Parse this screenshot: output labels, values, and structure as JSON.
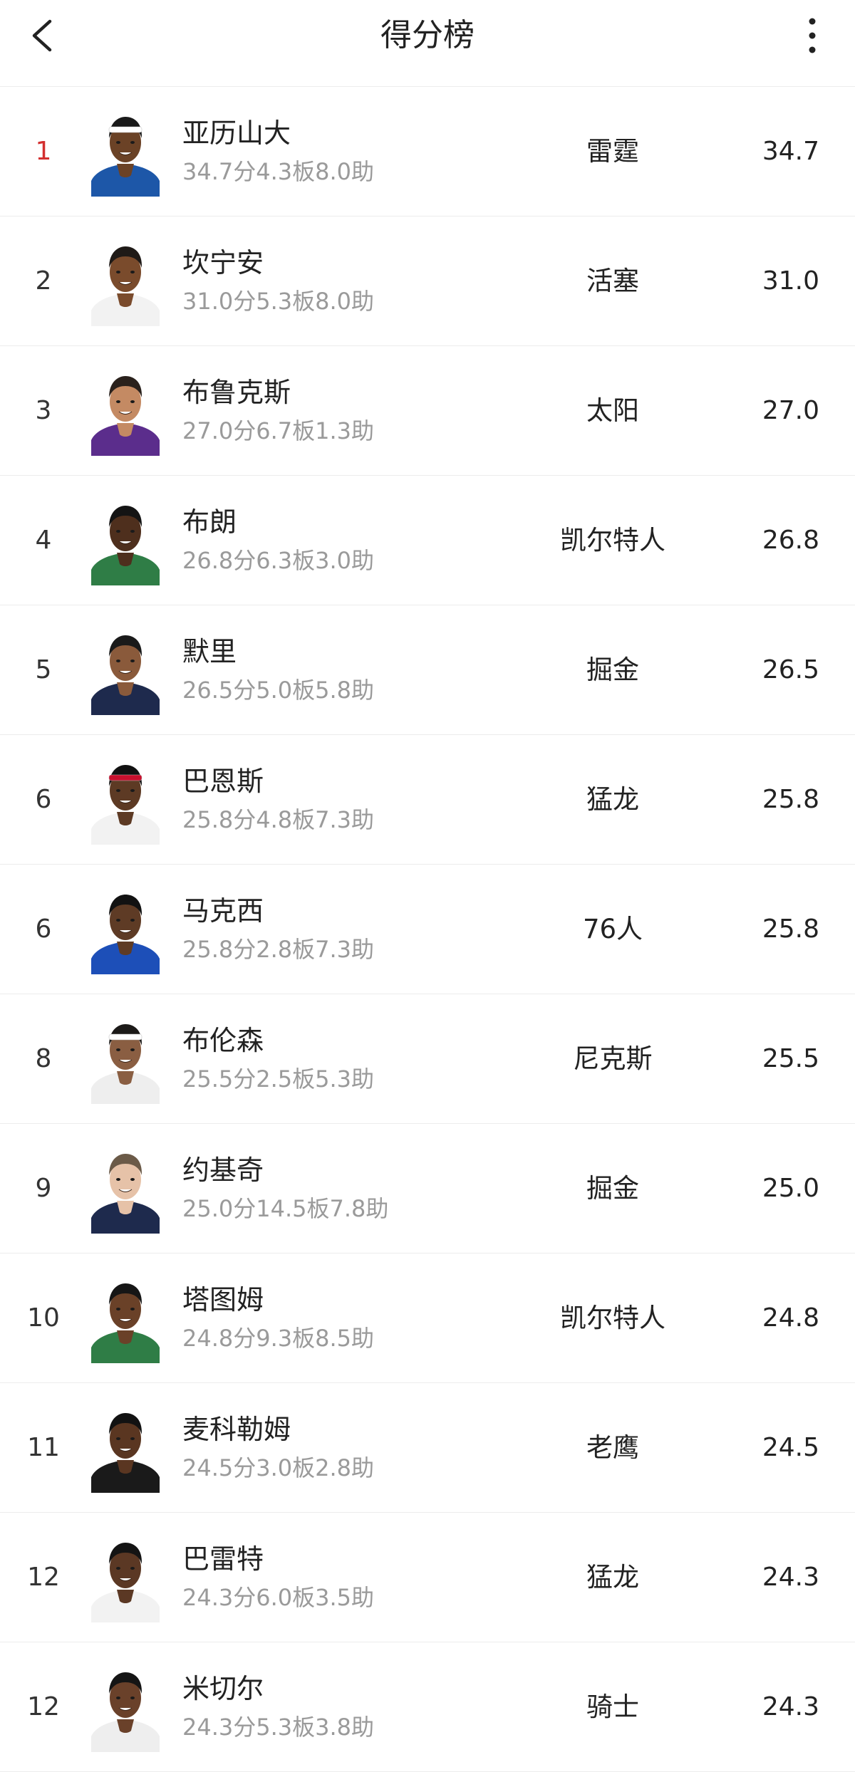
{
  "header": {
    "title": "得分榜",
    "back_icon": "chevron-left-icon",
    "more_icon": "more-vertical-icon"
  },
  "colors": {
    "rank_highlight": "#d32f2f",
    "stats_text": "#9a9a9a",
    "divider": "#ececec"
  },
  "players": [
    {
      "rank": "1",
      "name": "亚历山大",
      "stats": "34.7分4.3板8.0助",
      "team": "雷霆",
      "points": "34.7",
      "jersey": "#1d57a8",
      "skin": "#6b4226",
      "hair": "#1a1a1a",
      "band": "#ffffff"
    },
    {
      "rank": "2",
      "name": "坎宁安",
      "stats": "31.0分5.3板8.0助",
      "team": "活塞",
      "points": "31.0",
      "jersey": "#f2f2f2",
      "skin": "#7a4b2c",
      "hair": "#1f1a17",
      "band": ""
    },
    {
      "rank": "3",
      "name": "布鲁克斯",
      "stats": "27.0分6.7板1.3助",
      "team": "太阳",
      "points": "27.0",
      "jersey": "#5b2d8c",
      "skin": "#c48a63",
      "hair": "#2a211c",
      "band": ""
    },
    {
      "rank": "4",
      "name": "布朗",
      "stats": "26.8分6.3板3.0助",
      "team": "凯尔特人",
      "points": "26.8",
      "jersey": "#2f7d46",
      "skin": "#4e2f1d",
      "hair": "#141414",
      "band": ""
    },
    {
      "rank": "5",
      "name": "默里",
      "stats": "26.5分5.0板5.8助",
      "team": "掘金",
      "points": "26.5",
      "jersey": "#1e2a4d",
      "skin": "#8a5a3b",
      "hair": "#1a1a1a",
      "band": ""
    },
    {
      "rank": "6",
      "name": "巴恩斯",
      "stats": "25.8分4.8板7.3助",
      "team": "猛龙",
      "points": "25.8",
      "jersey": "#f2f2f2",
      "skin": "#5d3a24",
      "hair": "#111111",
      "band": "#c8102e"
    },
    {
      "rank": "6",
      "name": "马克西",
      "stats": "25.8分2.8板7.3助",
      "team": "76人",
      "points": "25.8",
      "jersey": "#1d4fb8",
      "skin": "#5e3b25",
      "hair": "#121212",
      "band": ""
    },
    {
      "rank": "8",
      "name": "布伦森",
      "stats": "25.5分2.5板5.3助",
      "team": "尼克斯",
      "points": "25.5",
      "jersey": "#eeeeee",
      "skin": "#8a5e42",
      "hair": "#1c1a18",
      "band": "#ffffff"
    },
    {
      "rank": "9",
      "name": "约基奇",
      "stats": "25.0分14.5板7.8助",
      "team": "掘金",
      "points": "25.0",
      "jersey": "#1e2a4d",
      "skin": "#e6c2a8",
      "hair": "#6b5a48",
      "band": ""
    },
    {
      "rank": "10",
      "name": "塔图姆",
      "stats": "24.8分9.3板8.5助",
      "team": "凯尔特人",
      "points": "24.8",
      "jersey": "#2f7d46",
      "skin": "#6a4128",
      "hair": "#161616",
      "band": ""
    },
    {
      "rank": "11",
      "name": "麦科勒姆",
      "stats": "24.5分3.0板2.8助",
      "team": "老鹰",
      "points": "24.5",
      "jersey": "#1a1a1a",
      "skin": "#5a3621",
      "hair": "#121212",
      "band": ""
    },
    {
      "rank": "12",
      "name": "巴雷特",
      "stats": "24.3分6.0板3.5助",
      "team": "猛龙",
      "points": "24.3",
      "jersey": "#f2f2f2",
      "skin": "#5b3824",
      "hair": "#141414",
      "band": ""
    },
    {
      "rank": "12",
      "name": "米切尔",
      "stats": "24.3分5.3板3.8助",
      "team": "骑士",
      "points": "24.3",
      "jersey": "#eeeeee",
      "skin": "#6a412a",
      "hair": "#151515",
      "band": ""
    }
  ]
}
